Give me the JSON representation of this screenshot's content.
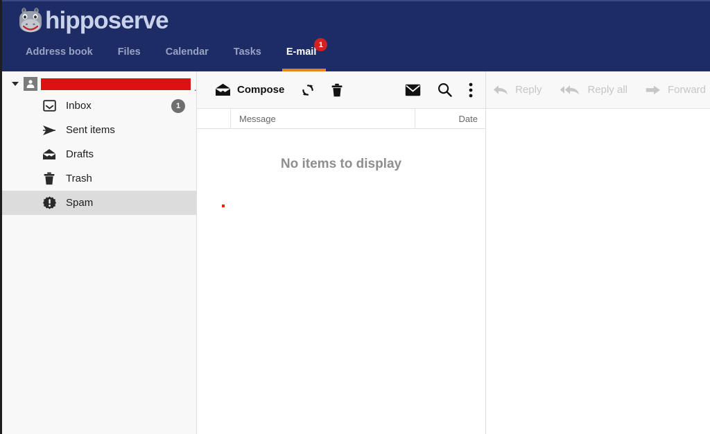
{
  "brand": {
    "name": "hipposerve",
    "logo_icon": "hippo-logo"
  },
  "nav": {
    "tabs": [
      {
        "label": "Address book",
        "active": false,
        "badge": null
      },
      {
        "label": "Files",
        "active": false,
        "badge": null
      },
      {
        "label": "Calendar",
        "active": false,
        "badge": null
      },
      {
        "label": "Tasks",
        "active": false,
        "badge": null
      },
      {
        "label": "E-mail",
        "active": true,
        "badge": "1"
      }
    ],
    "active_underline_color": "#e8821a",
    "badge_color": "#d32020",
    "bar_color": "#1e2c66"
  },
  "sidebar": {
    "account": {
      "caret_icon": "caret-down-icon",
      "avatar_icon": "person-icon",
      "name_redacted": true,
      "redaction_color": "#dd1111",
      "trailing_text": "."
    },
    "folders": [
      {
        "label": "Inbox",
        "icon": "inbox-icon",
        "badge": "1",
        "selected": false
      },
      {
        "label": "Sent items",
        "icon": "send-icon",
        "badge": null,
        "selected": false
      },
      {
        "label": "Drafts",
        "icon": "drafts-icon",
        "badge": null,
        "selected": false
      },
      {
        "label": "Trash",
        "icon": "trash-icon",
        "badge": null,
        "selected": false
      },
      {
        "label": "Spam",
        "icon": "spam-icon",
        "badge": null,
        "selected": true
      }
    ]
  },
  "list_toolbar": {
    "compose_label": "Compose",
    "compose_icon": "open-envelope-icon",
    "refresh_icon": "refresh-icon",
    "delete_icon": "trash-icon",
    "mark_unread_icon": "envelope-icon",
    "search_icon": "search-icon",
    "more_icon": "kebab-menu-icon"
  },
  "message_list": {
    "columns": {
      "select": "",
      "message": "Message",
      "date": "Date"
    },
    "rows": [],
    "empty_text": "No items to display",
    "marker_color": "#ee2200"
  },
  "reading_pane": {
    "actions": [
      {
        "label": "Reply",
        "icon": "reply-icon",
        "disabled": true
      },
      {
        "label": "Reply all",
        "icon": "reply-all-icon",
        "disabled": true
      },
      {
        "label": "Forward",
        "icon": "forward-icon",
        "disabled": true
      }
    ],
    "content": ""
  }
}
